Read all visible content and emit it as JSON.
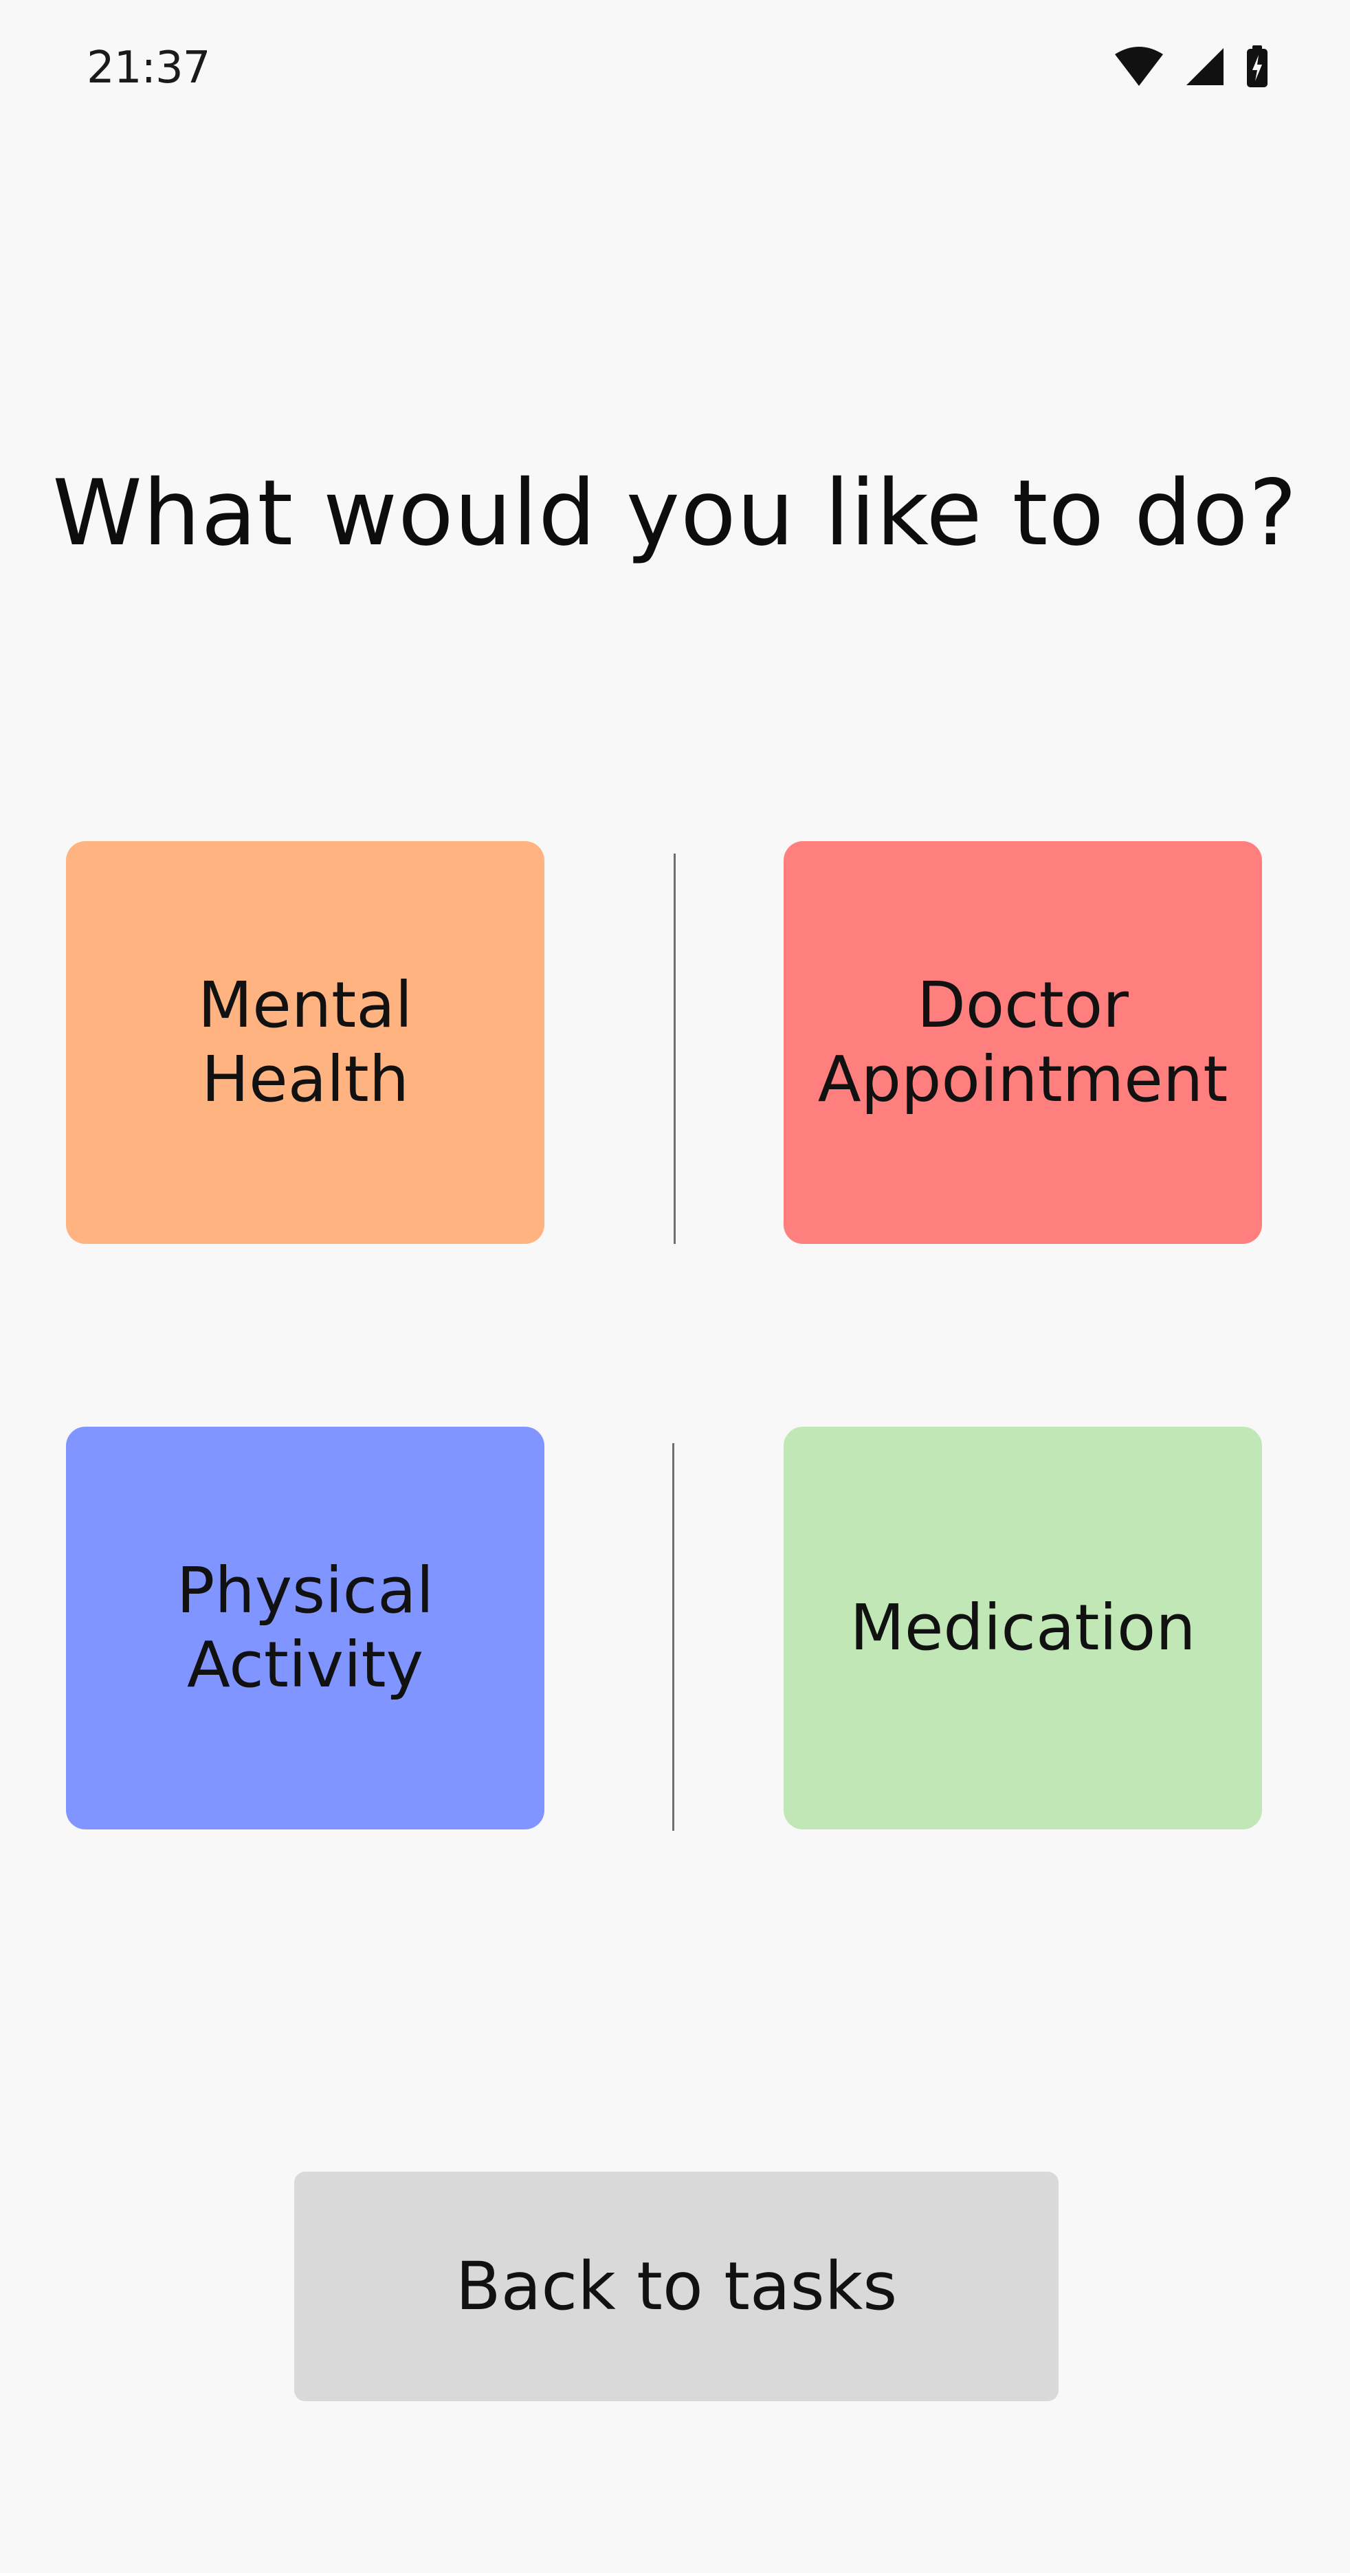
{
  "status_bar": {
    "time": "21:37",
    "icons": [
      "wifi-icon",
      "cellular-signal-icon",
      "battery-charging-icon"
    ]
  },
  "page": {
    "title": "What would you like to do?"
  },
  "tiles": [
    {
      "id": "mental-health",
      "label": "Mental\nHealth",
      "color": "#ffb380"
    },
    {
      "id": "doctor-appointment",
      "label": "Doctor\nAppointment",
      "color": "#ff7e7e"
    },
    {
      "id": "physical-activity",
      "label": "Physical\nActivity",
      "color": "#8095ff"
    },
    {
      "id": "medication",
      "label": "Medication",
      "color": "#c0e7b5"
    }
  ],
  "actions": {
    "back_label": "Back to tasks",
    "back_color": "#d9d9d9"
  }
}
